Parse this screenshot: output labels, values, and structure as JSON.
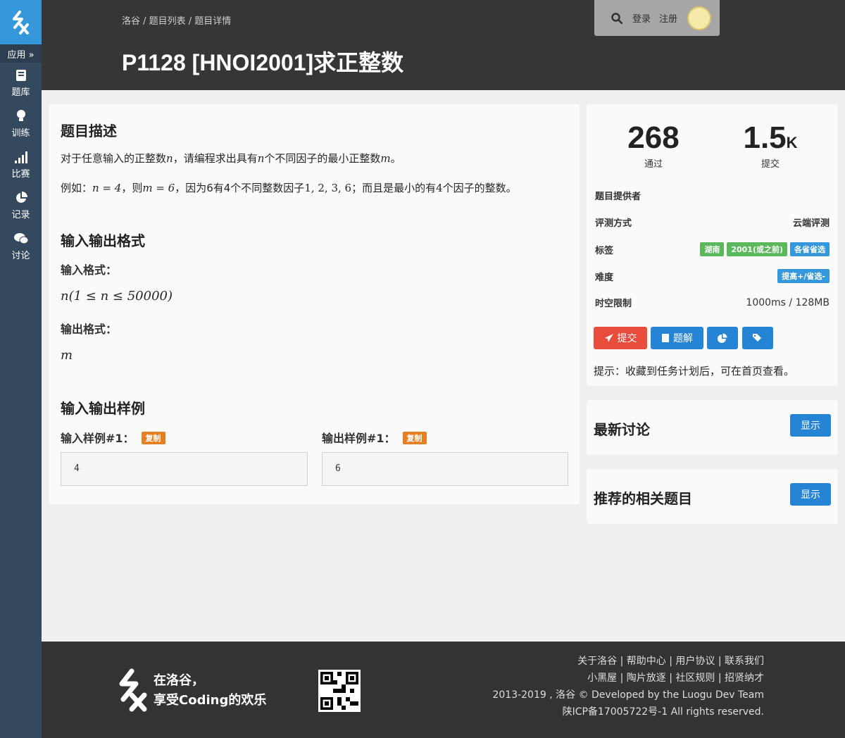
{
  "sidebar": {
    "app_label": "应用 »",
    "items": [
      {
        "label": "题库",
        "icon": "book-icon"
      },
      {
        "label": "训练",
        "icon": "lightbulb-icon"
      },
      {
        "label": "比赛",
        "icon": "bar-chart-icon"
      },
      {
        "label": "记录",
        "icon": "pie-chart-icon"
      },
      {
        "label": "讨论",
        "icon": "comments-icon"
      }
    ]
  },
  "header": {
    "breadcrumb": "洛谷 / 题目列表 / 题目详情",
    "title": "P1128 [HNOI2001]求正整数",
    "login": "登录",
    "register": "注册"
  },
  "problem": {
    "desc_title": "题目描述",
    "desc_line1_a": "对于任意输入的正整数",
    "desc_line1_n": "n",
    "desc_line1_b": "，请编程求出具有",
    "desc_line1_n2": "n",
    "desc_line1_c": "个不同因子的最小正整数",
    "desc_line1_m": "m",
    "desc_line1_d": "。",
    "desc_line2_a": "例如：",
    "desc_line2_n": "n = 4",
    "desc_line2_b": "，则",
    "desc_line2_m": "m = 6",
    "desc_line2_c": "，因为6有4个不同整数因子",
    "desc_line2_f": "1, 2, 3, 6",
    "desc_line2_d": "；而且是最小的有",
    "desc_line2_4": "4",
    "desc_line2_e": "个因子的整数。",
    "io_title": "输入输出格式",
    "input_label": "输入格式：",
    "input_math": "n(1 ≤ n ≤ 50000)",
    "output_label": "输出格式：",
    "output_math": "m",
    "sample_title": "输入输出样例",
    "sample_in_label": "输入样例#1：",
    "sample_out_label": "输出样例#1：",
    "copy_label": "复制",
    "sample_in": "4",
    "sample_out": "6"
  },
  "info": {
    "passed": "268",
    "passed_label": "通过",
    "submitted": "1.5",
    "submitted_unit": "K",
    "submitted_label": "提交",
    "provider_label": "题目提供者",
    "judge_label": "评测方式",
    "judge_value": "云端评测",
    "tags_label": "标签",
    "tags": [
      {
        "text": "湖南",
        "color": "#5cb85c"
      },
      {
        "text": "2001(或之前)",
        "color": "#5cb85c"
      },
      {
        "text": "各省省选",
        "color": "#3498db"
      }
    ],
    "difficulty_label": "难度",
    "difficulty_value": "提高+/省选-",
    "difficulty_color": "#3498db",
    "limit_label": "时空限制",
    "limit_value": "1000ms / 128MB",
    "submit_btn": "提交",
    "solution_btn": "题解",
    "tip": "提示：收藏到任务计划后，可在首页查看。"
  },
  "discuss": {
    "title": "最新讨论",
    "show": "显示"
  },
  "related": {
    "title": "推荐的相关题目",
    "show": "显示"
  },
  "footer": {
    "slogan1": "在洛谷，",
    "slogan2": "享受Coding的欢乐",
    "links1": "关于洛谷 | 帮助中心 | 用户协议 | 联系我们",
    "links2": "小黑屋 | 陶片放逐 | 社区规则 | 招贤纳才",
    "copyright": "2013-2019 , 洛谷 © Developed by the Luogu Dev Team",
    "icp": "陕ICP备17005722号-1 All rights reserved."
  },
  "colors": {
    "sidebar": "#34495e",
    "accent": "#3498db",
    "submit": "#e74c3c",
    "button": "#2684d5",
    "copy_badge": "#e67e22"
  }
}
